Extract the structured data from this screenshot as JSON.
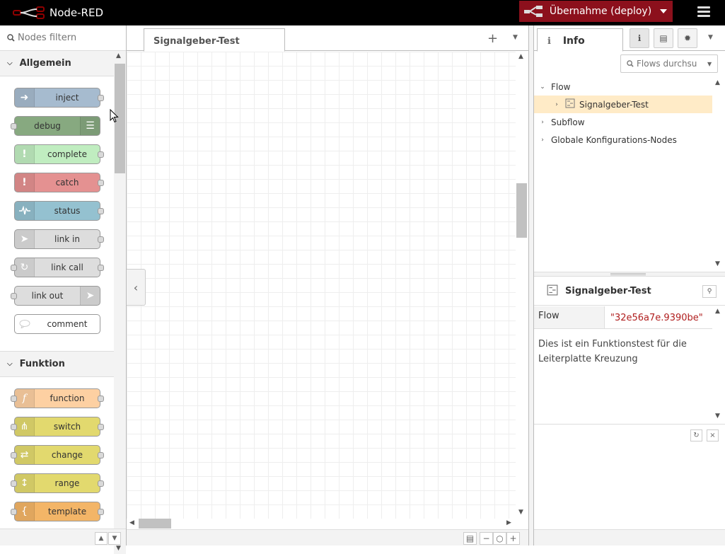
{
  "header": {
    "app_title": "Node-RED",
    "deploy_label": "Übernahme (deploy)"
  },
  "palette": {
    "search_placeholder": "Nodes filtern",
    "categories": [
      {
        "name": "Allgemein",
        "nodes": [
          {
            "label": "inject",
            "color": "#a6bbcf",
            "icon": "arrow-in-icon"
          },
          {
            "label": "debug",
            "color": "#87a980",
            "icon": "list-icon"
          },
          {
            "label": "complete",
            "color": "#c0edc0",
            "icon": "exclamation-icon"
          },
          {
            "label": "catch",
            "color": "#e49191",
            "icon": "exclamation-icon"
          },
          {
            "label": "status",
            "color": "#94c1d0",
            "icon": "pulse-icon"
          },
          {
            "label": "link in",
            "color": "#dddddd",
            "icon": "link-in-icon"
          },
          {
            "label": "link call",
            "color": "#dddddd",
            "icon": "link-call-icon"
          },
          {
            "label": "link out",
            "color": "#dddddd",
            "icon": "link-out-icon"
          },
          {
            "label": "comment",
            "color": "#ffffff",
            "icon": "comment-icon"
          }
        ]
      },
      {
        "name": "Funktion",
        "nodes": [
          {
            "label": "function",
            "color": "#fdd0a2",
            "icon": "function-icon"
          },
          {
            "label": "switch",
            "color": "#e2d96e",
            "icon": "switch-icon"
          },
          {
            "label": "change",
            "color": "#e2d96e",
            "icon": "shuffle-icon"
          },
          {
            "label": "range",
            "color": "#e2d96e",
            "icon": "range-icon"
          },
          {
            "label": "template",
            "color": "#f3b567",
            "icon": "brace-icon"
          }
        ]
      }
    ]
  },
  "workspace": {
    "tab_label": "Signalgeber-Test"
  },
  "sidebar": {
    "tab_label": "Info",
    "search_placeholder": "Flows durchsu",
    "tree": {
      "flow_label": "Flow",
      "flow_child": "Signalgeber-Test",
      "subflow_label": "Subflow",
      "global_label": "Globale Konfigurations-Nodes"
    },
    "info": {
      "title": "Signalgeber-Test",
      "prop_key": "Flow",
      "prop_value": "\"32e56a7e.9390be\"",
      "description": "Dies ist ein Funktionstest für die Leiterplatte Kreuzung"
    }
  },
  "colors": {
    "header_bg": "#000000",
    "deploy_bg": "#8c101c",
    "selected_row": "#ffebc7",
    "prop_value": "#b01e1e"
  }
}
